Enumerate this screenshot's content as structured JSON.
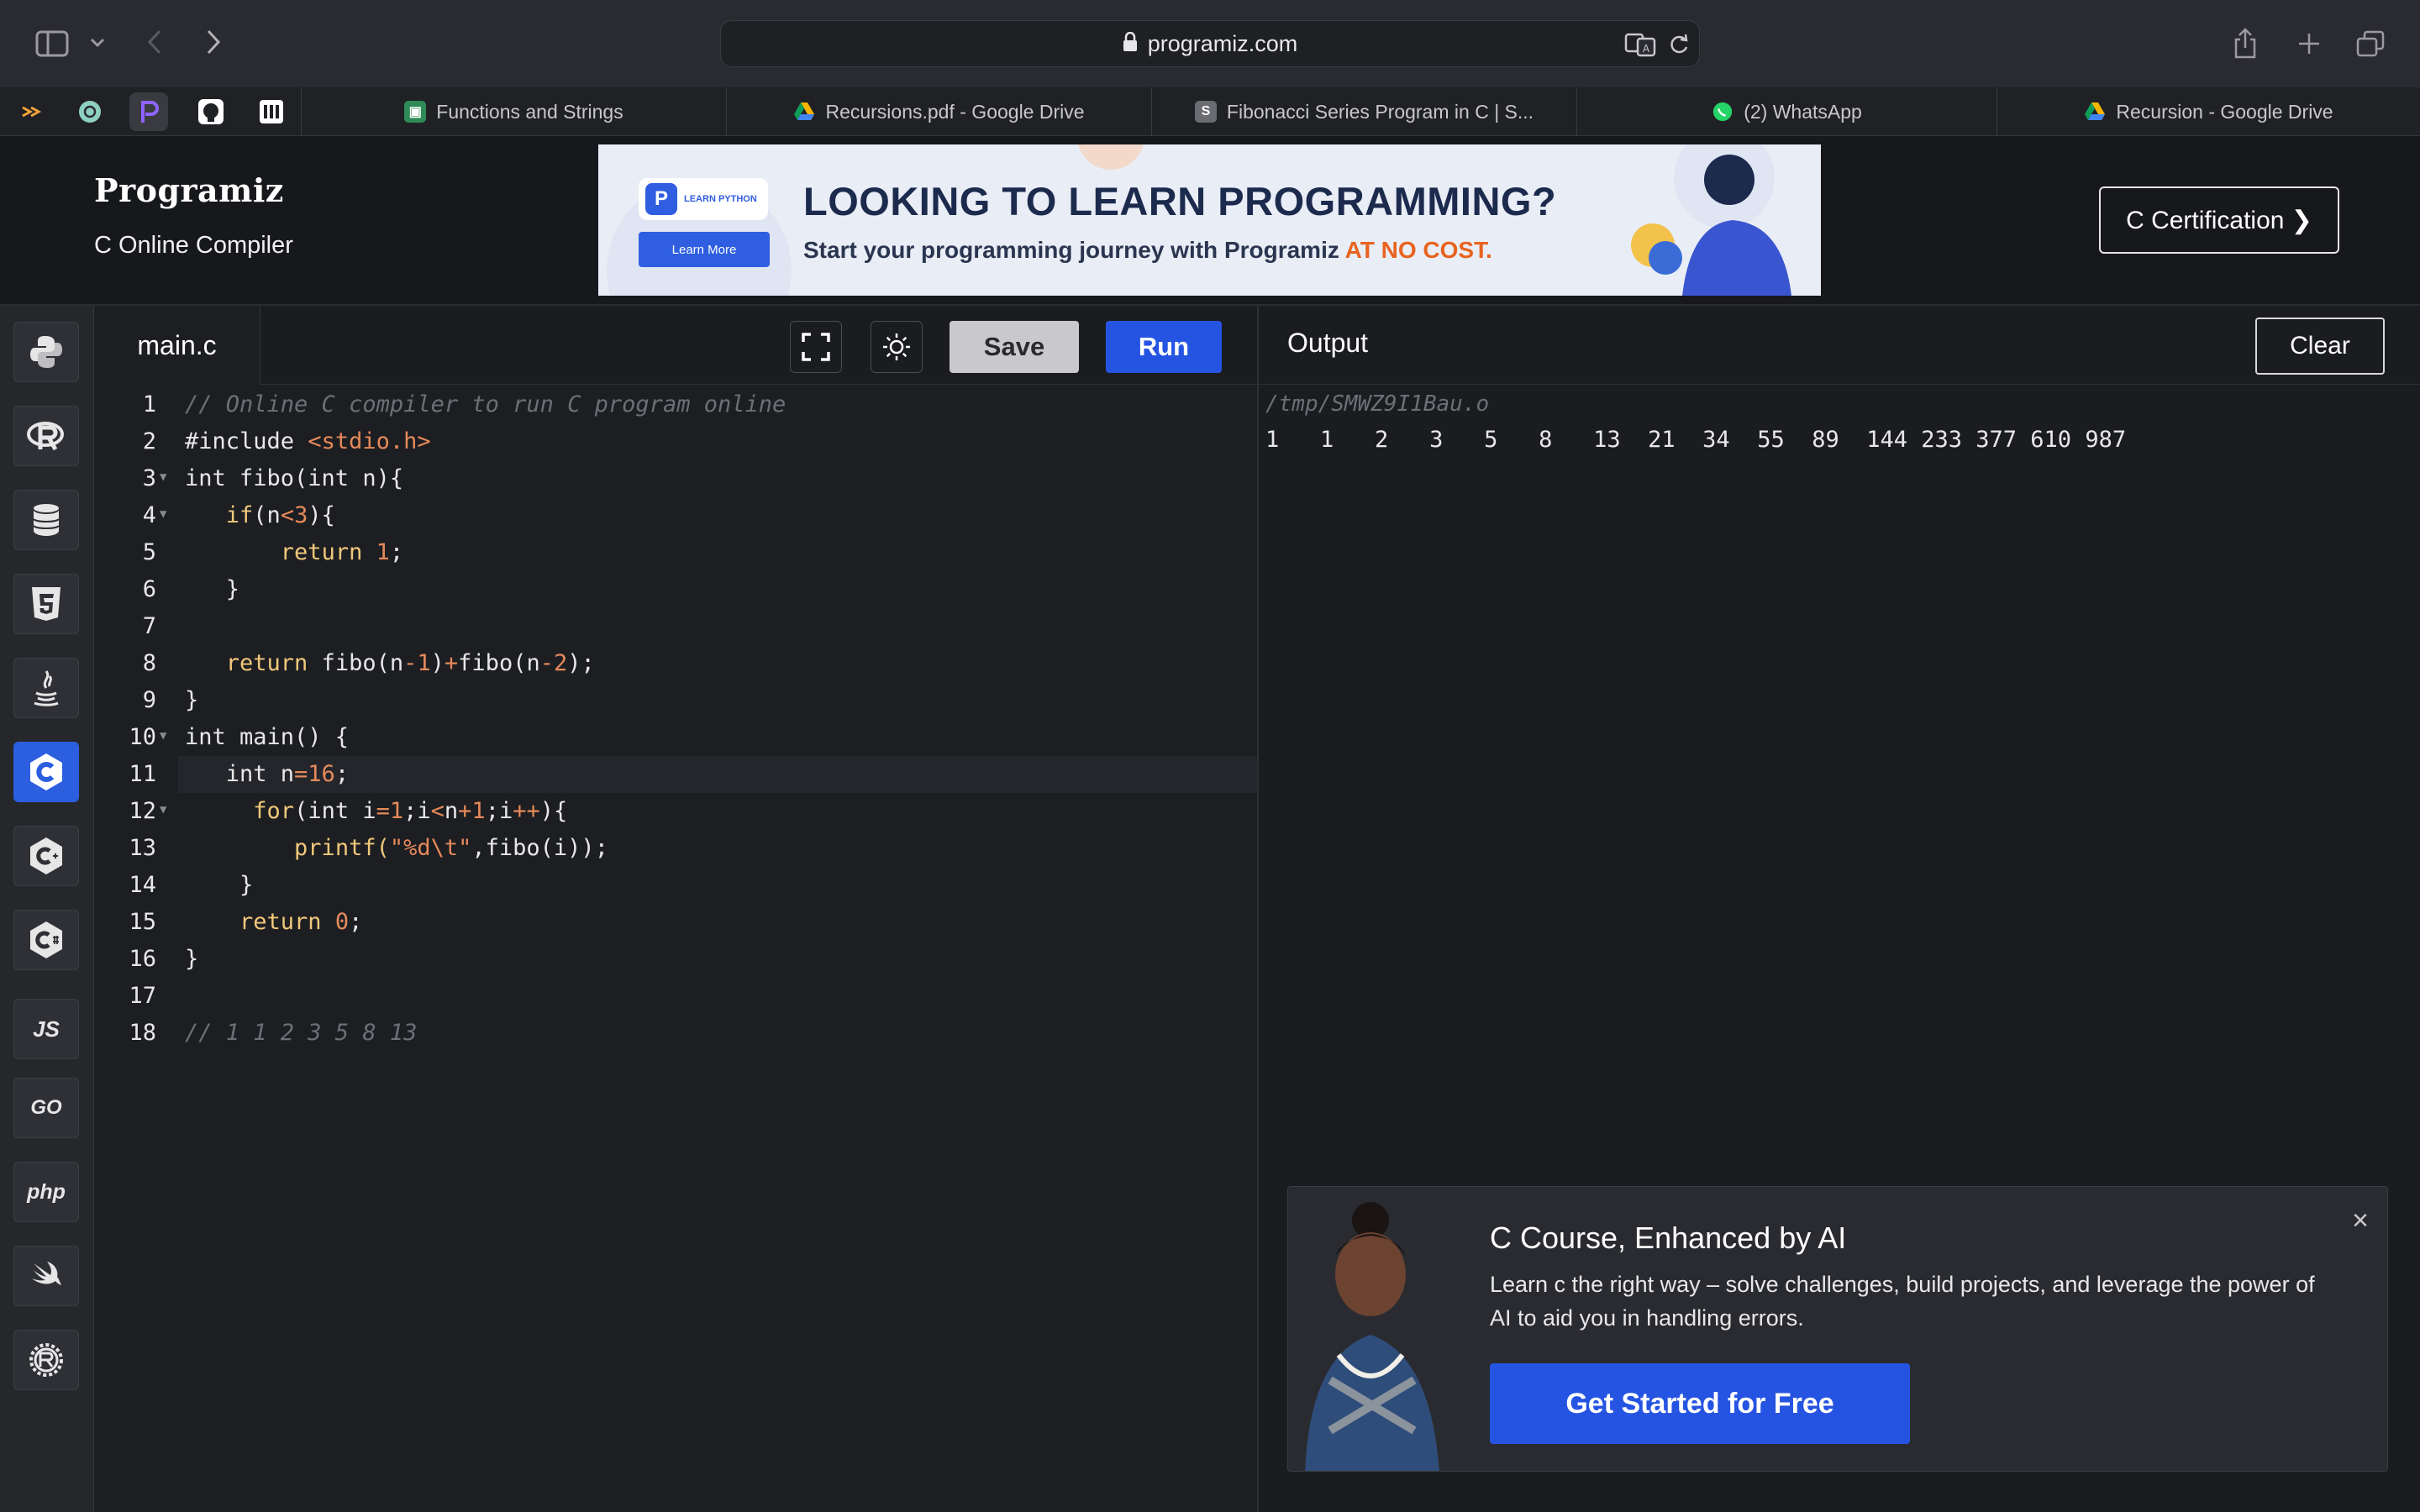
{
  "browser": {
    "address": "programiz.com",
    "tabs": [
      {
        "label": "Functions and Strings",
        "icon": "google-classroom-icon"
      },
      {
        "label": "Recursions.pdf - Google Drive",
        "icon": "google-drive-icon"
      },
      {
        "label": "Fibonacci Series Program in C | S...",
        "icon": "s-favicon-icon"
      },
      {
        "label": "(2) WhatsApp",
        "icon": "whatsapp-icon"
      },
      {
        "label": "Recursion - Google Drive",
        "icon": "google-drive-icon"
      }
    ],
    "pinned": [
      "bolt-icon",
      "chatgpt-icon",
      "programiz-icon",
      "github-icon",
      "notion-icon"
    ]
  },
  "site": {
    "logo": "Programiz",
    "subtitle": "C Online Compiler",
    "certification_button": "C Certification ❯"
  },
  "banner": {
    "badge_text": "LEARN PYTHON",
    "learn_more": "Learn More",
    "headline": "LOOKING TO LEARN PROGRAMMING?",
    "sub": "Start your programming journey with Programiz ",
    "sub_accent": "AT NO COST.",
    "colors": {
      "accent": "#e8631f",
      "brand": "#2f5ee0"
    }
  },
  "sidebar": {
    "languages": [
      {
        "name": "python-icon"
      },
      {
        "name": "r-icon"
      },
      {
        "name": "sql-icon"
      },
      {
        "name": "html5-icon"
      },
      {
        "name": "java-icon"
      },
      {
        "name": "c-icon",
        "active": true
      },
      {
        "name": "cpp-icon"
      },
      {
        "name": "csharp-icon"
      },
      {
        "name": "javascript-icon",
        "text": "JS"
      },
      {
        "name": "go-icon",
        "text": "GO"
      },
      {
        "name": "php-icon",
        "text": "php"
      },
      {
        "name": "swift-icon"
      },
      {
        "name": "rust-icon"
      }
    ]
  },
  "editor": {
    "filename": "main.c",
    "save_label": "Save",
    "run_label": "Run",
    "line_numbers": [
      "1",
      "2",
      "3",
      "4",
      "5",
      "6",
      "7",
      "8",
      "9",
      "10",
      "11",
      "12",
      "13",
      "14",
      "15",
      "16",
      "17",
      "18"
    ]
  },
  "output": {
    "title": "Output",
    "clear_label": "Clear",
    "path": "/tmp/SMWZ9I1Bau.o",
    "result": "1   1   2   3   5   8   13  21  34  55  89  144 233 377 610 987"
  },
  "promo": {
    "title": "C Course, Enhanced by AI",
    "description": "Learn c the right way – solve challenges, build projects, and leverage the power of AI to aid you in handling errors.",
    "cta": "Get Started for Free",
    "close": "×"
  }
}
